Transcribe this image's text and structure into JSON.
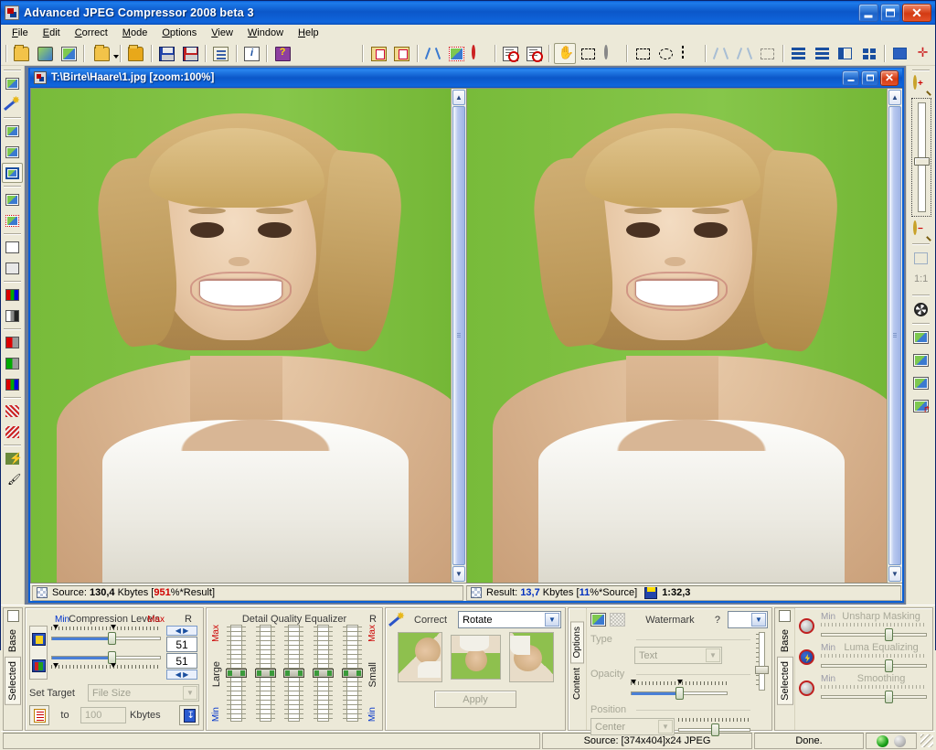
{
  "window": {
    "title": "Advanced JPEG Compressor 2008 beta 3",
    "icon": "app-icon",
    "buttons": {
      "minimize": "_",
      "maximize": "❐",
      "close": "✕"
    }
  },
  "menu": [
    {
      "label": "File"
    },
    {
      "label": "Edit"
    },
    {
      "label": "Correct"
    },
    {
      "label": "Mode"
    },
    {
      "label": "Options"
    },
    {
      "label": "View"
    },
    {
      "label": "Window"
    },
    {
      "label": "Help"
    }
  ],
  "toolbar": {
    "groups": [
      [
        "open-image-icon",
        "scan-image-icon",
        "screen-capture-icon",
        "open-folder-icon"
      ],
      [
        "refresh-image-icon",
        "save-image-icon",
        "save-as-image-icon"
      ],
      [
        "batch-icon",
        "info-icon",
        "help-book-icon"
      ],
      [
        "copy-icon",
        "paste-icon",
        "cut-icon",
        "crop-icon",
        "deselect-icon",
        "properties-icon"
      ],
      [
        "hand-tool-icon",
        "select-tool-icon",
        "magic-select-icon"
      ],
      [
        "rect-select-icon",
        "ellipse-select-icon",
        "polygon-select-icon"
      ],
      [
        "cut-region-icon",
        "cut-region-2-icon",
        "clear-region-icon"
      ],
      [
        "cascade-windows-icon",
        "tile-horizontal-icon",
        "tile-vertical-icon",
        "arrange-icons-icon"
      ],
      [
        "new-window-icon",
        "center-image-icon"
      ]
    ]
  },
  "left_toolbar": [
    "screen-mode-icon",
    "correct-wand-icon",
    "preview-source-icon",
    "preview-result-icon",
    "preview-both-icon",
    "compare-icon",
    "compare-selection-icon",
    "palette-icon",
    "palette-2-icon",
    "rgb-channels-icon",
    "grayscale-icon",
    "channel-r-icon",
    "channel-g-icon",
    "channel-rgb-icon",
    "grid-red-icon",
    "grid-red-2-icon",
    "lightning-icon",
    "dropper-icon"
  ],
  "right_toolbar": {
    "zoom_in": "zoom-in-icon",
    "zoom_out": "zoom-out-icon",
    "zoom_slider": "zoom-slider",
    "items": [
      "fit-window-icon",
      "zoom-1-1-icon",
      "film-icon",
      "thumb-1-icon",
      "thumb-2-icon",
      "thumb-3-icon",
      "thumb-add-icon"
    ]
  },
  "document": {
    "title": "T:\\Birte\\Haare\\1.jpg  [zoom:100%]",
    "buttons": {
      "minimize": "_",
      "maximize": "❐",
      "close": "✕"
    },
    "status": {
      "source_label": "Source:",
      "source_size": "130,4",
      "source_unit": "Kbytes",
      "source_ratio_open": "[",
      "source_ratio_value": "951",
      "source_ratio_rest": "%*Result]",
      "result_label": "Result:",
      "result_size": "13,7",
      "result_unit": "Kbytes",
      "result_ratio_open": "[",
      "result_ratio_value": "11",
      "result_ratio_rest": "%*Source]",
      "compression_ratio": "1:32,3"
    }
  },
  "panels": {
    "left_tabs": {
      "checkbox": "",
      "base": "Base",
      "selected": "Selected"
    },
    "compression": {
      "title": "Compression Levels",
      "min": "Min",
      "max": "Max",
      "r": "R",
      "value_luma": "51",
      "value_chroma": "51",
      "set_target_label": "Set Target",
      "target_type": "File Size",
      "to_label": "to",
      "target_value": "100",
      "target_unit": "Kbytes",
      "icon_luma": "luma-levels-icon",
      "icon_chroma": "chroma-levels-icon",
      "icon_target": "target-file-icon",
      "icon_apply_target": "apply-target-icon"
    },
    "equalizer": {
      "title": "Detail Quality Equalizer",
      "left_max": "Max",
      "left_mid": "Large",
      "left_min": "Min",
      "right_label": "R",
      "right_max": "Max",
      "right_mid": "Small",
      "right_min": "Min",
      "slider_count": 5,
      "slider_values": [
        50,
        50,
        50,
        50,
        50
      ]
    },
    "correct": {
      "icon": "correct-wand-icon",
      "label": "Correct",
      "mode": "Rotate",
      "previews": [
        "rotate-left-preview",
        "rotate-180-preview",
        "rotate-right-preview"
      ],
      "apply_label": "Apply"
    },
    "watermark": {
      "tab_options": "Options",
      "tab_content": "Content",
      "title": "Watermark",
      "help": "?",
      "icon_text": "watermark-text-icon",
      "icon_image": "watermark-image-icon",
      "type_label": "Type",
      "type_value": "Text",
      "opacity_label": "Opacity",
      "position_label": "Position",
      "position_value": "Center"
    },
    "right_group": {
      "tab_checkbox": "",
      "tab_base": "Base",
      "tab_selected": "Selected",
      "sliders": [
        {
          "label": "Unsharp Masking",
          "min": "Min",
          "icon": "unsharp-icon"
        },
        {
          "label": "Luma Equalizing",
          "min": "Min",
          "icon": "luma-eq-icon"
        },
        {
          "label": "Smoothing",
          "min": "Min",
          "icon": "smoothing-icon"
        }
      ]
    }
  },
  "statusbar": {
    "source_info": "Source: [374x404]x24 JPEG",
    "state": "Done.",
    "led_active": "green",
    "led_idle": "gray"
  },
  "colors": {
    "titlebar_blue": "#0b57c9",
    "panel": "#ece9d8",
    "accent_red": "#cc0000",
    "accent_blue": "#0033cc",
    "image_bg_green": "#7fbf3f"
  }
}
